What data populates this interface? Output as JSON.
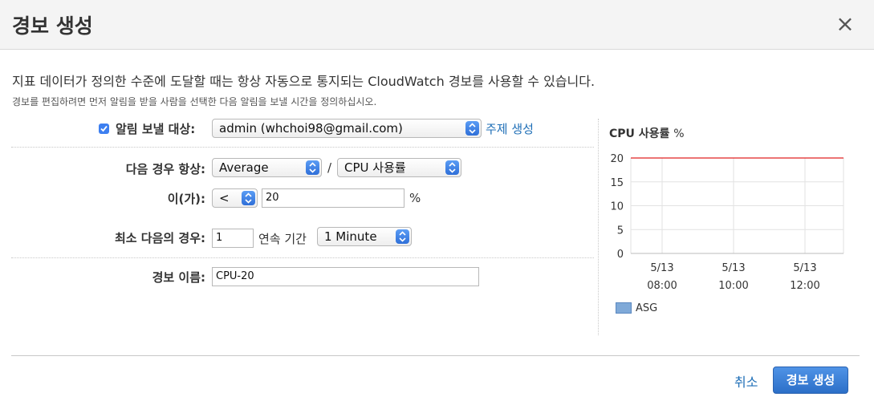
{
  "dialog": {
    "title": "경보 생성",
    "close_icon": "×",
    "description": "지표 데이터가 정의한 수준에 도달할 때는 항상 자동으로 통지되는 CloudWatch 경보를 사용할 수 있습니다.",
    "subdescription": "경보를 편집하려면 먼저 알림을 받을 사람을 선택한 다음 알림을 보낼 시간을 정의하십시오."
  },
  "form": {
    "notify_label": "알림 보낼 대상:",
    "notify_checked": true,
    "notify_target": "admin (whchoi98@gmail.com)",
    "create_topic_link": "주제 생성",
    "whenever_label": "다음 경우 항상:",
    "statistic": "Average",
    "slash": "/",
    "metric": "CPU 사용률",
    "is_label": "이(가):",
    "operator": "<",
    "threshold": "20",
    "percent": "%",
    "period_label": "최소 다음의 경우:",
    "periods": "1",
    "consecutive_label": "연속 기간",
    "period": "1 Minute",
    "name_label": "경보 이름:",
    "alarm_name": "CPU-20"
  },
  "chart_data": {
    "type": "line",
    "title": "CPU 사용률",
    "unit": "%",
    "y_ticks": [
      "20",
      "15",
      "10",
      "5",
      "0"
    ],
    "ylim": [
      0,
      20
    ],
    "x_ticks": [
      {
        "date": "5/13",
        "time": "08:00"
      },
      {
        "date": "5/13",
        "time": "10:00"
      },
      {
        "date": "5/13",
        "time": "12:00"
      }
    ],
    "threshold_line": 20,
    "threshold_color": "#e02020",
    "series": [
      {
        "name": "ASG",
        "values": []
      }
    ],
    "grid": true
  },
  "footer": {
    "cancel_label": "취소",
    "create_label": "경보 생성"
  }
}
